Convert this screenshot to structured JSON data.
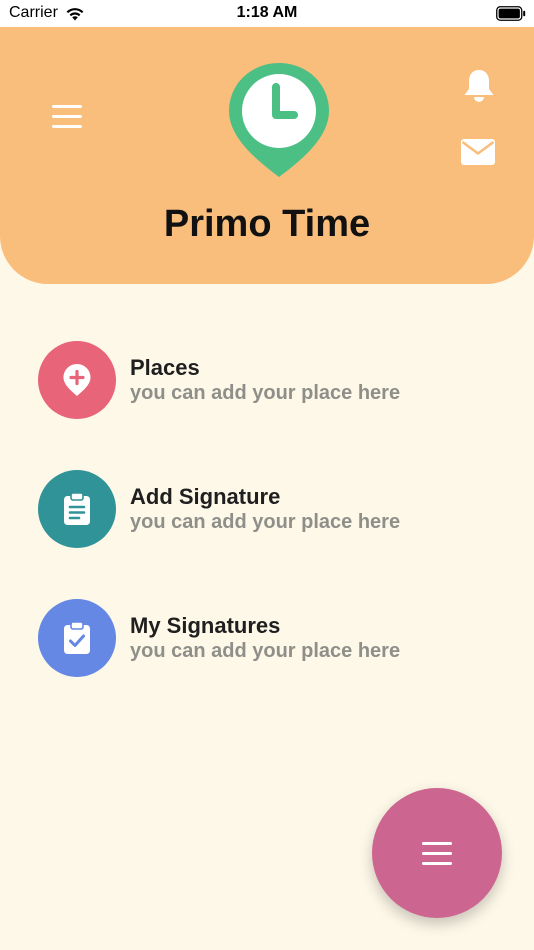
{
  "status_bar": {
    "carrier": "Carrier",
    "time": "1:18 AM"
  },
  "header": {
    "title": "Primo Time",
    "icons": [
      "menu-icon",
      "clock-location-logo-icon",
      "bell-icon",
      "mail-icon"
    ]
  },
  "menu": {
    "items": [
      {
        "title": "Places",
        "subtitle": "you can add your place here",
        "icon": "add-location-icon",
        "color": "#e76479"
      },
      {
        "title": "Add Signature",
        "subtitle": "you can add your place here",
        "icon": "clipboard-text-icon",
        "color": "#309397"
      },
      {
        "title": "My Signatures",
        "subtitle": "you can add your place here",
        "icon": "clipboard-check-icon",
        "color": "#6488e4"
      }
    ]
  },
  "fab": {
    "icon": "menu-icon",
    "color": "#cc6690"
  },
  "colors": {
    "header": "#f9be7c",
    "background": "#fef8e9",
    "logo": "#4cbf85"
  }
}
